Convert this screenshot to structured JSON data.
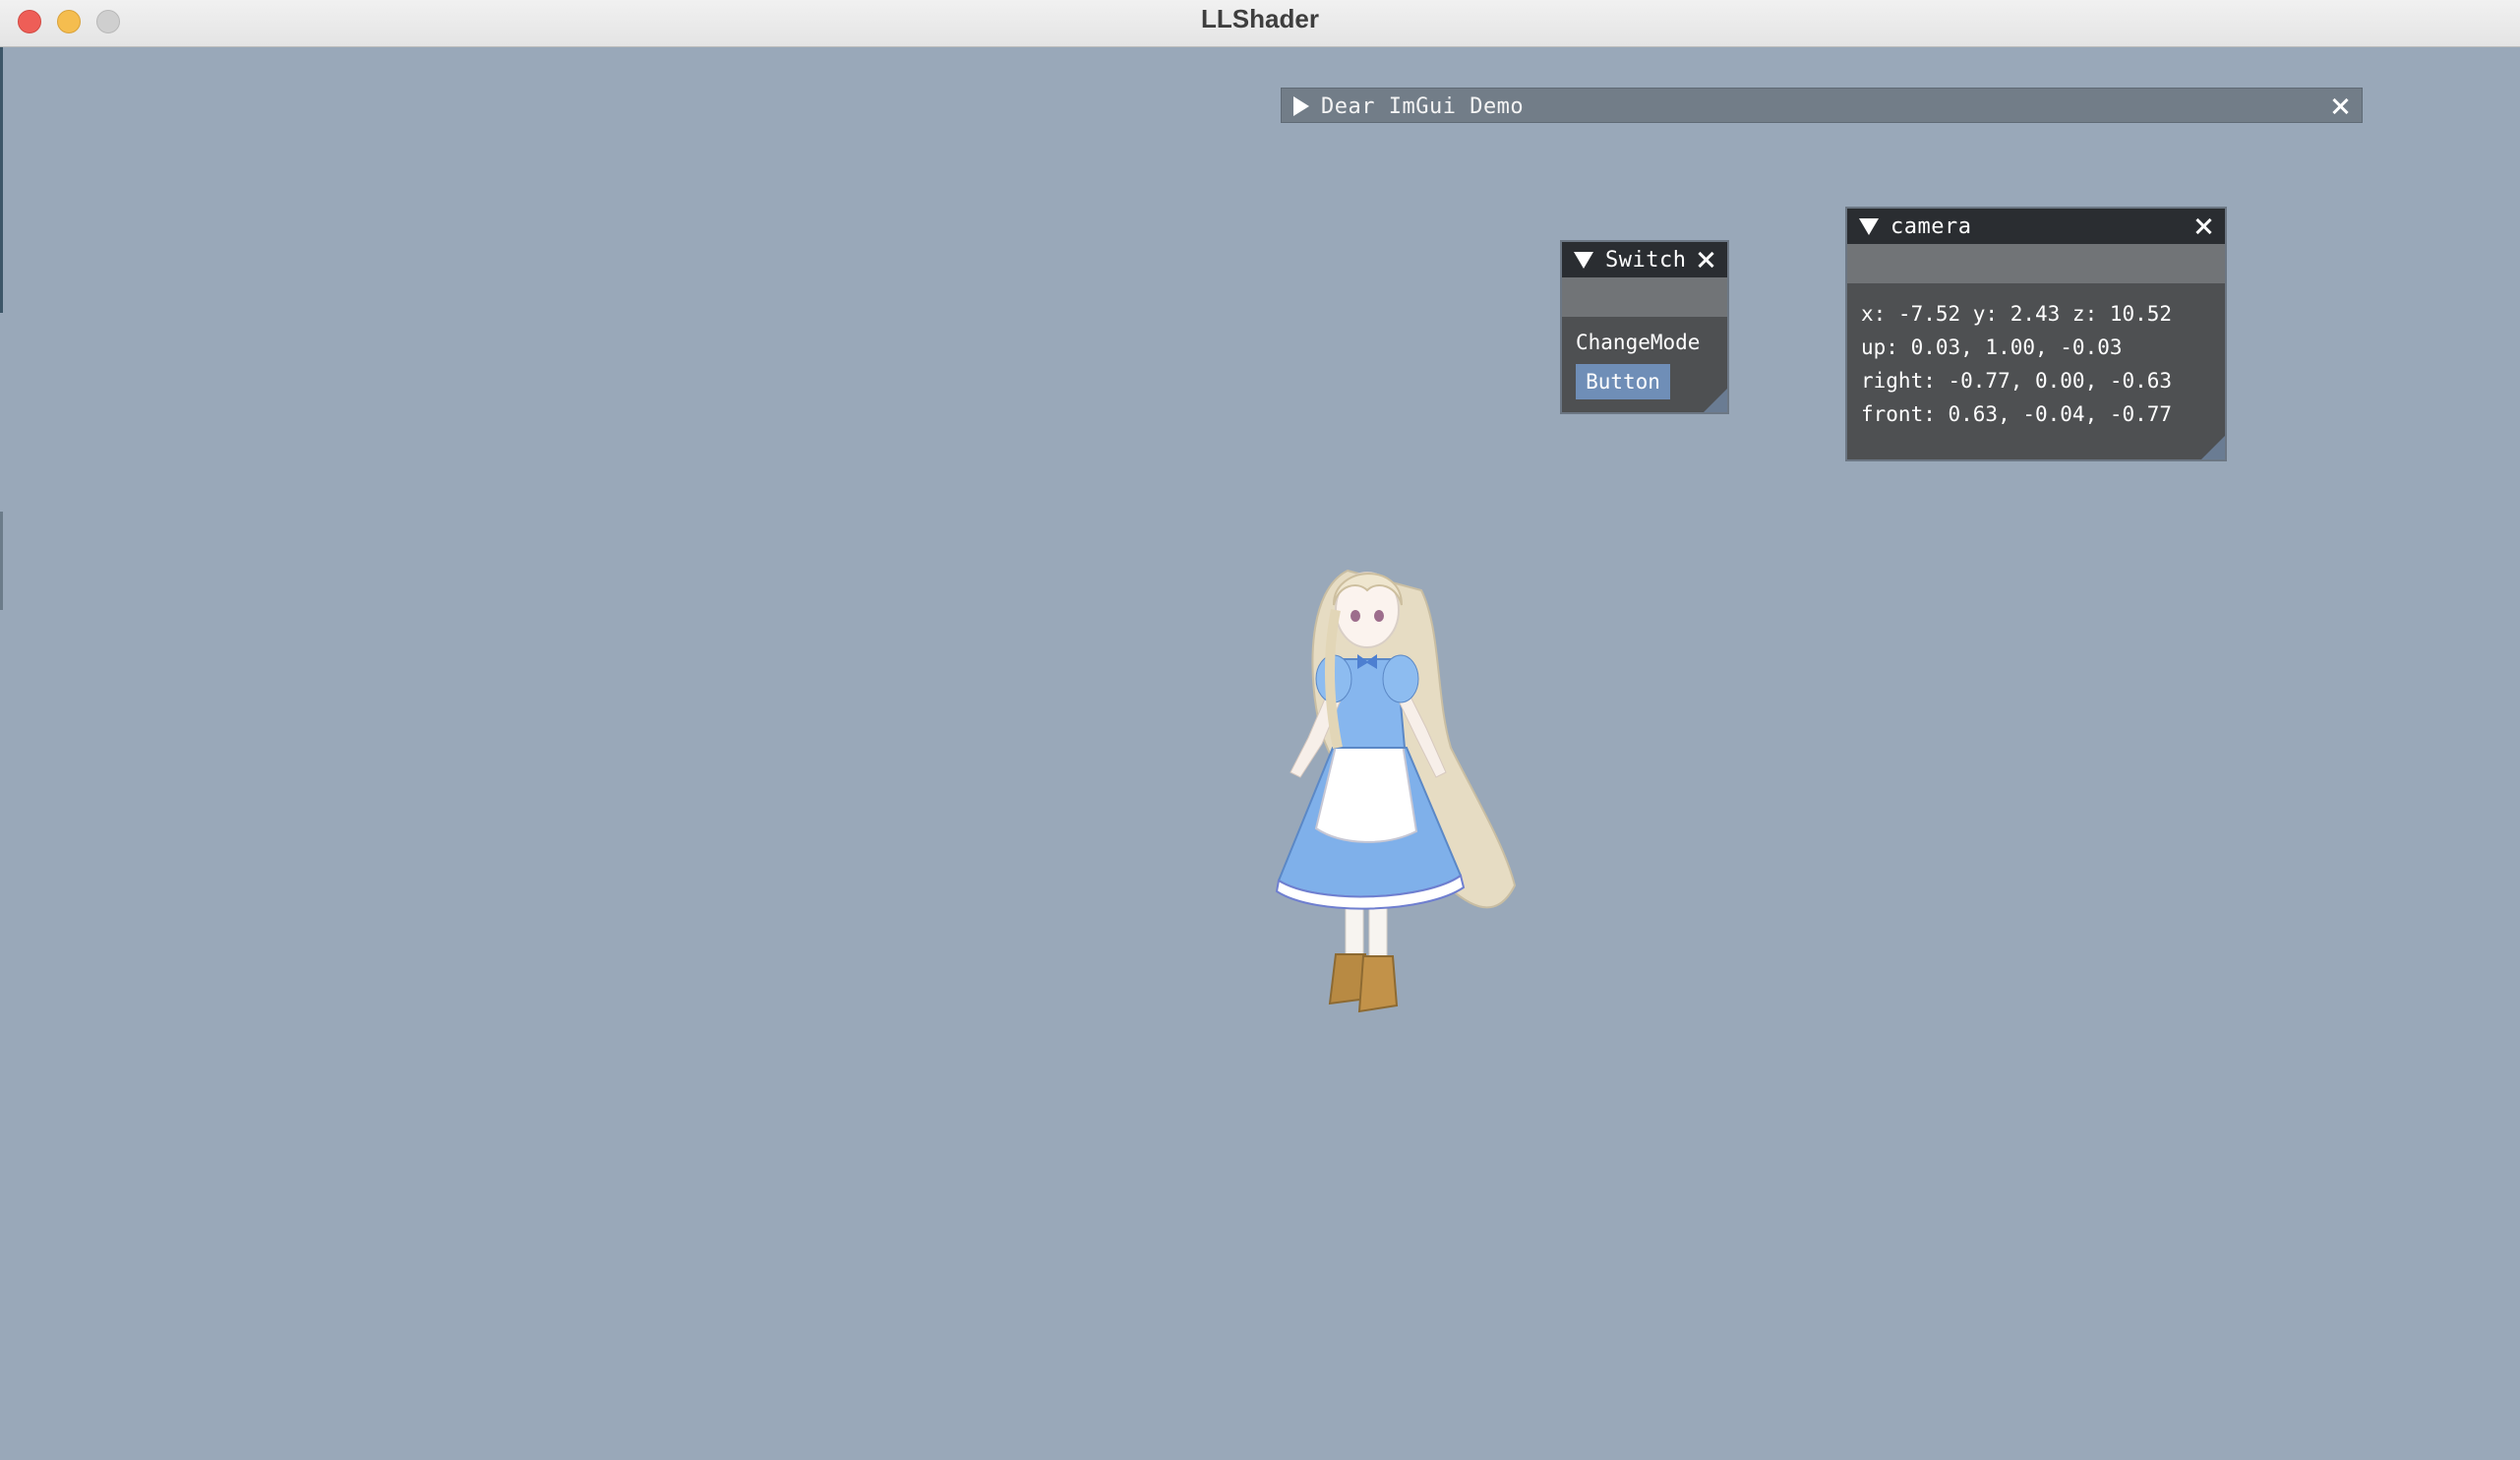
{
  "window": {
    "title": "LLShader"
  },
  "demo_window": {
    "title": "Dear ImGui Demo"
  },
  "switch_window": {
    "title": "Switch",
    "label": "ChangeMode",
    "button_label": "Button"
  },
  "camera_window": {
    "title": "camera",
    "position_line": "x: -7.52 y: 2.43 z: 10.52",
    "up_line": "up: 0.03, 1.00, -0.03",
    "right_line": "right: -0.77, 0.00, -0.63",
    "front_line": "front: 0.63, -0.04, -0.77"
  },
  "colors": {
    "viewport_bg": "#99a8b9",
    "imgui_title_bg": "#2a2d31",
    "imgui_button": "#6f8eb7",
    "close_button": "#ee5e57",
    "minimize_button": "#f5bd4f"
  }
}
